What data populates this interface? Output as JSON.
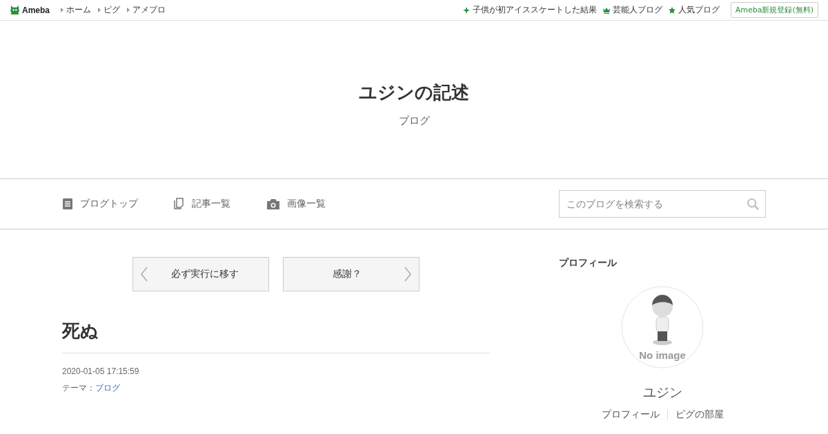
{
  "topbar": {
    "logo": "Ameba",
    "links": [
      "ホーム",
      "ピグ",
      "アメブロ"
    ],
    "right_links": [
      {
        "kind": "sparkle",
        "label": "子供が初アイススケートした結果"
      },
      {
        "kind": "crown",
        "label": "芸能人ブログ"
      },
      {
        "kind": "star",
        "label": "人気ブログ"
      }
    ],
    "signup": "Ameba新規登録(無料)"
  },
  "header": {
    "title": "ユジンの記述",
    "subtitle": "ブログ"
  },
  "nav": {
    "items": [
      {
        "kind": "doc",
        "label": "ブログトップ"
      },
      {
        "kind": "pages",
        "label": "記事一覧"
      },
      {
        "kind": "camera",
        "label": "画像一覧"
      }
    ],
    "search": {
      "placeholder": "このブログを検索する"
    }
  },
  "pager": {
    "prev": "必ず実行に移す",
    "next": "感謝？"
  },
  "article": {
    "title": "死ぬ",
    "date": "2020-01-05 17:15:59",
    "theme_label": "テーマ：",
    "theme": "ブログ"
  },
  "profile": {
    "heading": "プロフィール",
    "avatar": {
      "kind": "picture",
      "label": "No image"
    },
    "name": "ユジン",
    "links": [
      "プロフィール",
      "ピグの部屋"
    ]
  }
}
